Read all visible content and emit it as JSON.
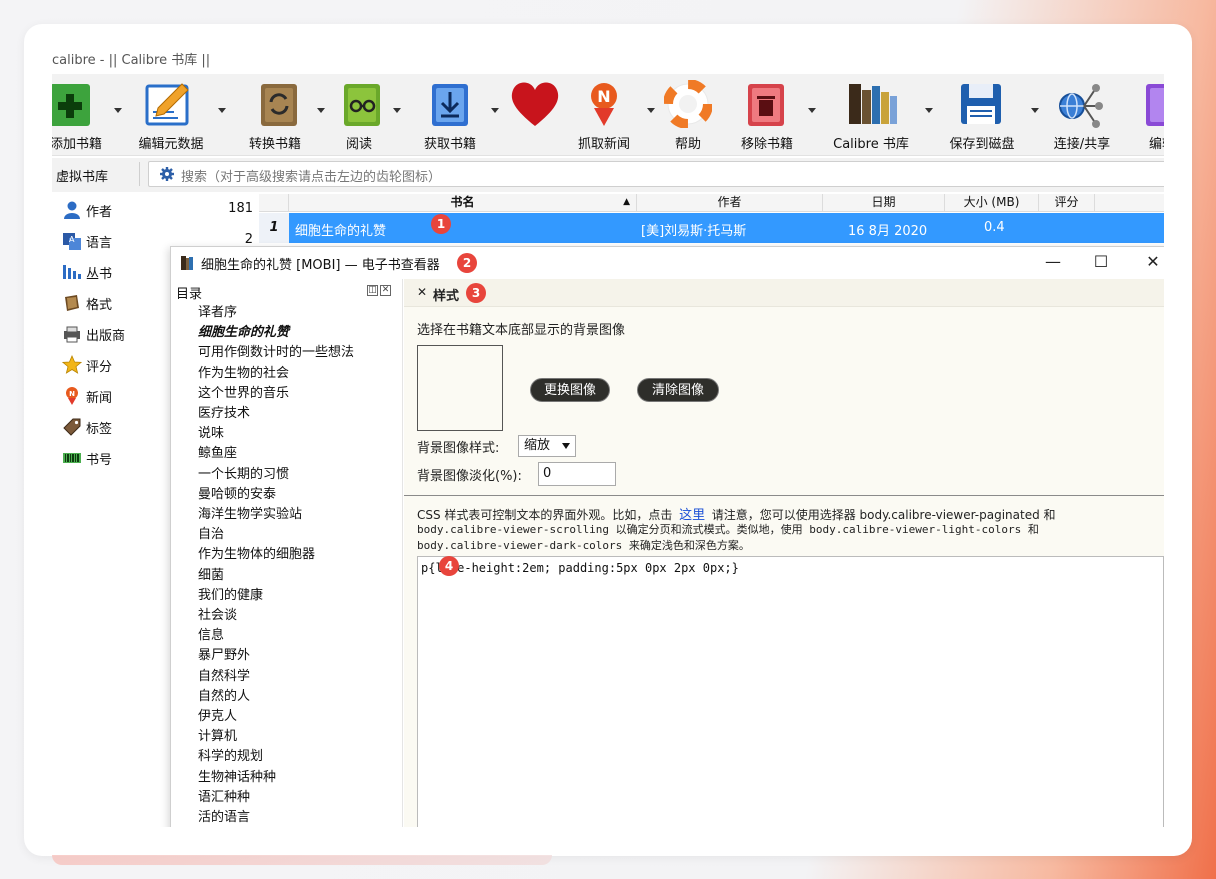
{
  "app": {
    "title": "calibre - || Calibre 书库 ||"
  },
  "toolbar": {
    "items": [
      {
        "label": "添加书籍",
        "icon": "add-book-icon"
      },
      {
        "label": "编辑元数据",
        "icon": "edit-metadata-icon"
      },
      {
        "label": "转换书籍",
        "icon": "convert-book-icon"
      },
      {
        "label": "阅读",
        "icon": "read-book-icon"
      },
      {
        "label": "获取书籍",
        "icon": "get-books-icon"
      },
      {
        "label": "",
        "icon": "donate-heart-icon"
      },
      {
        "label": "抓取新闻",
        "icon": "fetch-news-icon"
      },
      {
        "label": "帮助",
        "icon": "help-lifebuoy-icon"
      },
      {
        "label": "移除书籍",
        "icon": "remove-book-icon"
      },
      {
        "label": "Calibre 书库",
        "icon": "library-icon"
      },
      {
        "label": "保存到磁盘",
        "icon": "save-disk-icon"
      },
      {
        "label": "连接/共享",
        "icon": "connect-share-icon"
      },
      {
        "label": "编辑",
        "icon": "edit-book-icon"
      }
    ]
  },
  "search": {
    "virtual_library": "虚拟书库",
    "placeholder": "搜索（对于高级搜索请点击左边的齿轮图标）"
  },
  "tag_browser": {
    "items": [
      {
        "label": "作者",
        "count": "181",
        "icon": "author-icon"
      },
      {
        "label": "语言",
        "count": "2",
        "icon": "language-icon"
      },
      {
        "label": "丛书",
        "count": "",
        "icon": "series-icon"
      },
      {
        "label": "格式",
        "count": "",
        "icon": "format-icon"
      },
      {
        "label": "出版商",
        "count": "",
        "icon": "publisher-icon"
      },
      {
        "label": "评分",
        "count": "",
        "icon": "rating-star-icon"
      },
      {
        "label": "新闻",
        "count": "",
        "icon": "news-icon"
      },
      {
        "label": "标签",
        "count": "",
        "icon": "tag-icon"
      },
      {
        "label": "书号",
        "count": "",
        "icon": "isbn-barcode-icon"
      }
    ]
  },
  "book_list": {
    "columns": [
      "书名",
      "作者",
      "日期",
      "大小 (MB)",
      "评分"
    ],
    "rows": [
      {
        "num": "1",
        "title": "细胞生命的礼赞",
        "author": "[美]刘易斯·托马斯",
        "date": "16 8月 2020",
        "size": "0.4",
        "rating": ""
      }
    ]
  },
  "viewer": {
    "title": "细胞生命的礼赞 [MOBI] — 电子书查看器",
    "toc_title": "目录",
    "toc": [
      "译者序",
      "细胞生命的礼赞",
      "可用作倒数计时的一些想法",
      "作为生物的社会",
      "这个世界的音乐",
      "医疗技术",
      "说味",
      "鲸鱼座",
      "一个长期的习惯",
      "曼哈顿的安泰",
      "海洋生物学实验站",
      "自治",
      "作为生物体的细胞器",
      "细菌",
      "我们的健康",
      "社会谈",
      "信息",
      "暴尸野外",
      "自然科学",
      "自然的人",
      "伊克人",
      "计算机",
      "科学的规划",
      "生物神话种种",
      "语汇种种",
      "活的语言"
    ],
    "toc_current": 1,
    "panel_title": "样式",
    "bg_image_label": "选择在书籍文本底部显示的背景图像",
    "change_image": "更换图像",
    "clear_image": "清除图像",
    "bg_style_label": "背景图像样式:",
    "bg_style_value": "缩放",
    "bg_fade_label": "背景图像淡化(%):",
    "bg_fade_value": "0",
    "css_desc_1a": "CSS 样式表可控制文本的界面外观。比如，点击",
    "css_desc_link": "这里",
    "css_desc_1b": "请注意，您可以使用选择器 body.calibre-viewer-paginated 和",
    "css_desc_2": "body.calibre-viewer-scrolling 以确定分页和流式模式。类似地，使用 body.calibre-viewer-light-colors 和",
    "css_desc_3": "body.calibre-viewer-dark-colors 来确定浅色和深色方案。",
    "css_code": "p{line-height:2em; padding:5px 0px 2px 0px;}"
  },
  "badges": [
    "1",
    "2",
    "3",
    "4"
  ]
}
